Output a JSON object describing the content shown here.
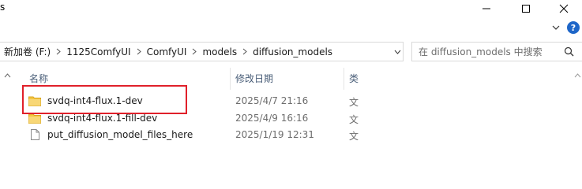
{
  "window": {
    "title_fragment": "s"
  },
  "address_bar": {
    "crumbs": [
      "新加卷 (F:)",
      "1125ComfyUI",
      "ComfyUI",
      "models",
      "diffusion_models"
    ]
  },
  "search": {
    "placeholder": "在 diffusion_models 中搜索"
  },
  "columns": {
    "name": "名称",
    "date_modified": "修改日期",
    "type": "类"
  },
  "files": [
    {
      "name": "svdq-int4-flux.1-dev",
      "date": "2025/4/7 21:16",
      "type": "文",
      "icon": "folder-icon"
    },
    {
      "name": "svdq-int4-flux.1-fill-dev",
      "date": "2025/4/9 16:16",
      "type": "文",
      "icon": "folder-icon"
    },
    {
      "name": "put_diffusion_model_files_here",
      "date": "2025/1/19 12:31",
      "type": "文",
      "icon": "file-icon"
    }
  ],
  "colors": {
    "folder": "#f4c542",
    "highlight": "#e0202a",
    "help": "#1e66c8",
    "header_text": "#4c607a"
  }
}
